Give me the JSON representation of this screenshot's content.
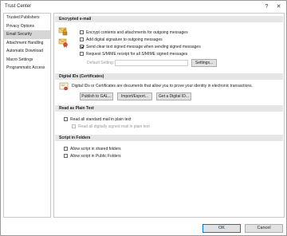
{
  "window": {
    "title": "Trust Center",
    "help_label": "?",
    "close_label": "✕"
  },
  "sidebar": {
    "items": [
      {
        "label": "Trusted Publishers",
        "selected": false
      },
      {
        "label": "Privacy Options",
        "selected": false
      },
      {
        "label": "Email Security",
        "selected": true
      },
      {
        "label": "Attachment Handling",
        "selected": false
      },
      {
        "label": "Automatic Download",
        "selected": false
      },
      {
        "label": "Macro Settings",
        "selected": false
      },
      {
        "label": "Programmatic Access",
        "selected": false
      }
    ]
  },
  "encrypted": {
    "header": "Encrypted e-mail",
    "options": [
      {
        "label": "Encrypt contents and attachments for outgoing messages",
        "checked": false,
        "disabled": false
      },
      {
        "label": "Add digital signature to outgoing messages",
        "checked": false,
        "disabled": false
      },
      {
        "label": "Send clear text signed message when sending signed messages",
        "checked": true,
        "disabled": false
      },
      {
        "label": "Request S/MIME receipt for all S/MIME signed messages",
        "checked": false,
        "disabled": false
      }
    ],
    "default_setting_label": "Default Setting:",
    "settings_button": "Settings..."
  },
  "digital_ids": {
    "header": "Digital IDs (Certificates)",
    "description": "Digital IDs or Certificates are documents that allow you to prove your identity in electronic transactions.",
    "buttons": [
      "Publish to GAL...",
      "Import/Export...",
      "Get a Digital ID..."
    ]
  },
  "plain_text": {
    "header": "Read as Plain Text",
    "options": [
      {
        "label": "Read all standard mail in plain text",
        "checked": false,
        "disabled": false
      },
      {
        "label": "Read all digitally signed mail in plain text",
        "checked": false,
        "disabled": true
      }
    ]
  },
  "script_folders": {
    "header": "Script in Folders",
    "options": [
      {
        "label": "Allow script in shared folders",
        "checked": false,
        "disabled": false
      },
      {
        "label": "Allow script in Public Folders",
        "checked": false,
        "disabled": false
      }
    ]
  },
  "footer": {
    "ok": "OK",
    "cancel": "Cancel"
  }
}
